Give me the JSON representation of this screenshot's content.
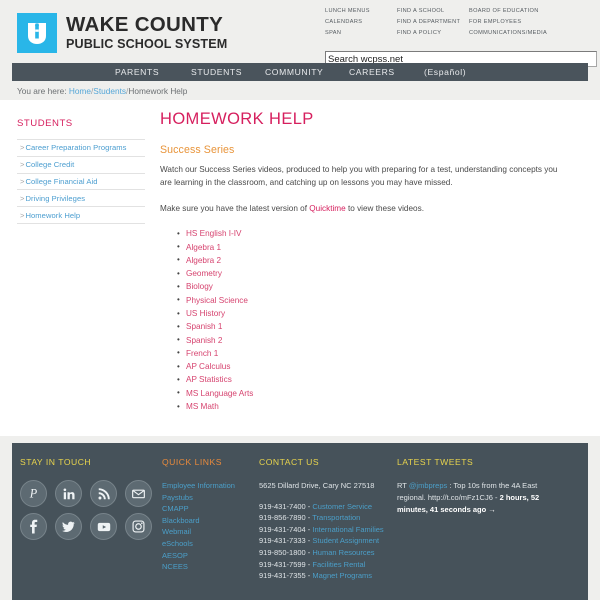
{
  "header": {
    "logo": {
      "line1": "WAKE COUNTY",
      "line2": "PUBLIC SCHOOL SYSTEM",
      "icon": "acorn-shield-icon",
      "color": "#29b6e8"
    },
    "quick_links": {
      "col1": [
        "LUNCH MENUS",
        "CALENDARS",
        "SPAN"
      ],
      "col2": [
        "FIND A SCHOOL",
        "FIND A DEPARTMENT",
        "FIND A POLICY"
      ],
      "col3": [
        "BOARD OF EDUCATION",
        "FOR EMPLOYEES",
        "COMMUNICATIONS/MEDIA"
      ]
    },
    "search": {
      "value": "Search wcpss.net",
      "placeholder": "Search wcpss.net"
    }
  },
  "nav": {
    "items": [
      "PARENTS",
      "STUDENTS",
      "COMMUNITY",
      "CAREERS",
      "(Español)"
    ]
  },
  "breadcrumb": {
    "prefix": "You are here:",
    "items": [
      "Home",
      "Students",
      "Homework Help"
    ],
    "separator": "/"
  },
  "sidebar": {
    "title": "STUDENTS",
    "items": [
      "Career Preparation Programs",
      "College Credit",
      "College Financial Aid",
      "Driving Privileges",
      "Homework Help"
    ],
    "caret": ">"
  },
  "main": {
    "title": "HOMEWORK HELP",
    "subtitle": "Success Series",
    "paragraph1": "Watch our Success Series videos, produced to help you with preparing for a test, understanding concepts you are learning in the classroom, and catching up on lessons you may have missed.",
    "paragraph2_before": "Make sure you have the latest version of ",
    "paragraph2_link": "Quicktime",
    "paragraph2_after": " to view these videos.",
    "subjects": [
      "HS English I-IV",
      "Algebra 1",
      "Algebra 2",
      "Geometry",
      "Biology",
      "Physical Science",
      "US History",
      "Spanish 1",
      "Spanish 2",
      "French 1",
      "AP Calculus",
      "AP Statistics",
      "MS Language Arts",
      "MS Math"
    ]
  },
  "footer": {
    "stay_in_touch": {
      "heading": "STAY IN TOUCH",
      "social": [
        "pinterest-icon",
        "linkedin-icon",
        "rss-icon",
        "email-icon",
        "facebook-icon",
        "twitter-icon",
        "youtube-icon",
        "instagram-icon"
      ]
    },
    "quick_links": {
      "heading": "QUICK LINKS",
      "items": [
        "Employee Information",
        "Paystubs",
        "CMAPP",
        "Blackboard",
        "Webmail",
        "eSchools",
        "AESOP",
        "NCEES"
      ]
    },
    "contact": {
      "heading": "CONTACT US",
      "address": "5625 Dillard Drive, Cary NC 27518",
      "phones": [
        {
          "number": "919-431-7400",
          "label": "Customer Service"
        },
        {
          "number": "919-856-7890",
          "label": "Transportation"
        },
        {
          "number": "919-431-7404",
          "label": "International Families"
        },
        {
          "number": "919-431-7333",
          "label": "Student Assignment"
        },
        {
          "number": "919-850-1800",
          "label": "Human Resources"
        },
        {
          "number": "919-431-7599",
          "label": "Facilities Rental"
        },
        {
          "number": "919-431-7355",
          "label": "Magnet Programs"
        }
      ],
      "dash": " - "
    },
    "tweets": {
      "heading": "LATEST TWEETS",
      "prefix": "RT ",
      "handle": "@jmbpreps",
      "body": " : Top 10s from the 4A East regional. ",
      "url": "http://t.co/mFz1CJ6",
      "dash": " - ",
      "ago": "2 hours, 52 minutes, 41 seconds ago →"
    }
  }
}
